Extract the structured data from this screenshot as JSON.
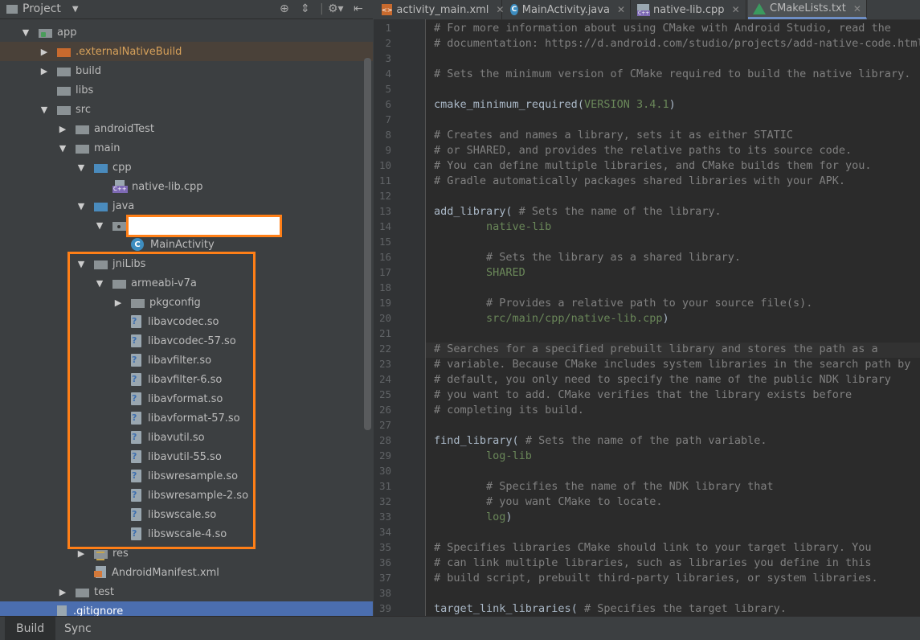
{
  "project_panel": {
    "title": "Project",
    "icons": [
      "target-icon",
      "collapse-icon",
      "gear-icon",
      "hide-icon"
    ],
    "tree": [
      {
        "label": "app",
        "depth": 0,
        "icon": "module",
        "arrow": "down"
      },
      {
        "label": ".externalNativeBuild",
        "depth": 1,
        "icon": "folder-orange",
        "arrow": "right",
        "style": "external"
      },
      {
        "label": "build",
        "depth": 1,
        "icon": "folder",
        "arrow": "right"
      },
      {
        "label": "libs",
        "depth": 1,
        "icon": "folder",
        "arrow": "none"
      },
      {
        "label": "src",
        "depth": 1,
        "icon": "folder",
        "arrow": "down"
      },
      {
        "label": "androidTest",
        "depth": 2,
        "icon": "folder",
        "arrow": "right"
      },
      {
        "label": "main",
        "depth": 2,
        "icon": "folder",
        "arrow": "down"
      },
      {
        "label": "cpp",
        "depth": 3,
        "icon": "folder-blue",
        "arrow": "down"
      },
      {
        "label": "native-lib.cpp",
        "depth": 4,
        "icon": "cpp",
        "arrow": "none"
      },
      {
        "label": "java",
        "depth": 3,
        "icon": "folder-blue",
        "arrow": "down"
      },
      {
        "label": "",
        "depth": 4,
        "icon": "package",
        "arrow": "down"
      },
      {
        "label": "MainActivity",
        "depth": 5,
        "icon": "class",
        "arrow": "none"
      },
      {
        "label": "jniLibs",
        "depth": 3,
        "icon": "folder",
        "arrow": "down"
      },
      {
        "label": "armeabi-v7a",
        "depth": 4,
        "icon": "folder",
        "arrow": "down"
      },
      {
        "label": "pkgconfig",
        "depth": 5,
        "icon": "folder",
        "arrow": "right"
      },
      {
        "label": "libavcodec.so",
        "depth": 5,
        "icon": "unknown-file",
        "arrow": "none"
      },
      {
        "label": "libavcodec-57.so",
        "depth": 5,
        "icon": "unknown-file",
        "arrow": "none"
      },
      {
        "label": "libavfilter.so",
        "depth": 5,
        "icon": "unknown-file",
        "arrow": "none"
      },
      {
        "label": "libavfilter-6.so",
        "depth": 5,
        "icon": "unknown-file",
        "arrow": "none"
      },
      {
        "label": "libavformat.so",
        "depth": 5,
        "icon": "unknown-file",
        "arrow": "none"
      },
      {
        "label": "libavformat-57.so",
        "depth": 5,
        "icon": "unknown-file",
        "arrow": "none"
      },
      {
        "label": "libavutil.so",
        "depth": 5,
        "icon": "unknown-file",
        "arrow": "none"
      },
      {
        "label": "libavutil-55.so",
        "depth": 5,
        "icon": "unknown-file",
        "arrow": "none"
      },
      {
        "label": "libswresample.so",
        "depth": 5,
        "icon": "unknown-file",
        "arrow": "none"
      },
      {
        "label": "libswresample-2.so",
        "depth": 5,
        "icon": "unknown-file",
        "arrow": "none"
      },
      {
        "label": "libswscale.so",
        "depth": 5,
        "icon": "unknown-file",
        "arrow": "none"
      },
      {
        "label": "libswscale-4.so",
        "depth": 5,
        "icon": "unknown-file",
        "arrow": "none"
      },
      {
        "label": "res",
        "depth": 3,
        "icon": "folder-res",
        "arrow": "right"
      },
      {
        "label": "AndroidManifest.xml",
        "depth": 3,
        "icon": "xml",
        "arrow": "none"
      },
      {
        "label": "test",
        "depth": 2,
        "icon": "folder",
        "arrow": "right"
      },
      {
        "label": ".gitignore",
        "depth": 1,
        "icon": "git",
        "arrow": "none",
        "style": "selected"
      }
    ]
  },
  "editor": {
    "tabs": [
      {
        "label": "activity_main.xml",
        "icon": "xml",
        "active": false
      },
      {
        "label": "MainActivity.java",
        "icon": "java",
        "active": false
      },
      {
        "label": "native-lib.cpp",
        "icon": "cpp",
        "active": false
      },
      {
        "label": "CMakeLists.txt",
        "icon": "cmake",
        "active": true
      }
    ],
    "current_line": 22,
    "lines": [
      [
        {
          "t": "# For more information about using CMake with Android Studio, read the",
          "c": "com"
        }
      ],
      [
        {
          "t": "# documentation: https://d.android.com/studio/projects/add-native-code.html",
          "c": "com"
        }
      ],
      [],
      [
        {
          "t": "# Sets the minimum version of CMake required to build the native library.",
          "c": "com"
        }
      ],
      [],
      [
        {
          "t": "cmake_minimum_required",
          "c": "fn"
        },
        {
          "t": "(",
          "c": "fn"
        },
        {
          "t": "VERSION 3.4.1",
          "c": "grn"
        },
        {
          "t": ")",
          "c": "fn"
        }
      ],
      [],
      [
        {
          "t": "# Creates and names a library, sets it as either STATIC",
          "c": "com"
        }
      ],
      [
        {
          "t": "# or SHARED, and provides the relative paths to its source code.",
          "c": "com"
        }
      ],
      [
        {
          "t": "# You can define multiple libraries, and CMake builds them for you.",
          "c": "com"
        }
      ],
      [
        {
          "t": "# Gradle automatically packages shared libraries with your APK.",
          "c": "com"
        }
      ],
      [],
      [
        {
          "t": "add_library",
          "c": "fn"
        },
        {
          "t": "( ",
          "c": "fn"
        },
        {
          "t": "# Sets the name of the library.",
          "c": "com"
        }
      ],
      [
        {
          "t": "        native-lib",
          "c": "grn"
        }
      ],
      [],
      [
        {
          "t": "        # Sets the library as a shared library.",
          "c": "com"
        }
      ],
      [
        {
          "t": "        SHARED",
          "c": "grn"
        }
      ],
      [],
      [
        {
          "t": "        # Provides a relative path to your source file(s).",
          "c": "com"
        }
      ],
      [
        {
          "t": "        src/main/cpp/native-lib.cpp",
          "c": "grn"
        },
        {
          "t": ")",
          "c": "fn"
        }
      ],
      [],
      [
        {
          "t": "# Searches for a specified prebuilt library and stores the path as a",
          "c": "com"
        }
      ],
      [
        {
          "t": "# variable. Because CMake includes system libraries in the search path by",
          "c": "com"
        }
      ],
      [
        {
          "t": "# default, you only need to specify the name of the public NDK library",
          "c": "com"
        }
      ],
      [
        {
          "t": "# you want to add. CMake verifies that the library exists before",
          "c": "com"
        }
      ],
      [
        {
          "t": "# completing its build.",
          "c": "com"
        }
      ],
      [],
      [
        {
          "t": "find_library",
          "c": "fn"
        },
        {
          "t": "( ",
          "c": "fn"
        },
        {
          "t": "# Sets the name of the path variable.",
          "c": "com"
        }
      ],
      [
        {
          "t": "        log-lib",
          "c": "grn"
        }
      ],
      [],
      [
        {
          "t": "        # Specifies the name of the NDK library that",
          "c": "com"
        }
      ],
      [
        {
          "t": "        # you want CMake to locate.",
          "c": "com"
        }
      ],
      [
        {
          "t": "        log",
          "c": "grn"
        },
        {
          "t": ")",
          "c": "fn"
        }
      ],
      [],
      [
        {
          "t": "# Specifies libraries CMake should link to your target library. You",
          "c": "com"
        }
      ],
      [
        {
          "t": "# can link multiple libraries, such as libraries you define in this",
          "c": "com"
        }
      ],
      [
        {
          "t": "# build script, prebuilt third-party libraries, or system libraries.",
          "c": "com"
        }
      ],
      [],
      [
        {
          "t": "target_link_libraries",
          "c": "fn"
        },
        {
          "t": "( ",
          "c": "fn"
        },
        {
          "t": "# Specifies the target library.",
          "c": "com"
        }
      ]
    ]
  },
  "status_bar": {
    "tabs": [
      {
        "label": "Build",
        "active": true
      },
      {
        "label": "Sync",
        "active": false
      }
    ]
  }
}
